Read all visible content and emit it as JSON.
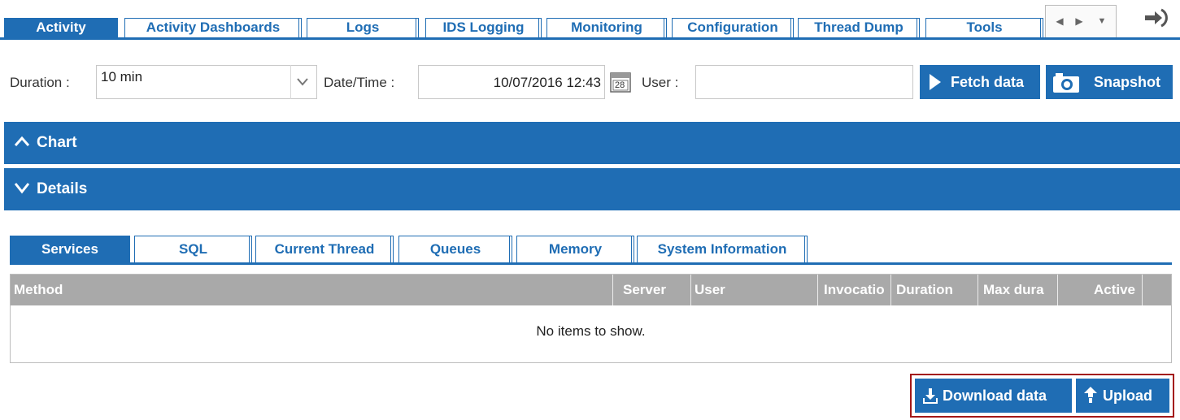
{
  "top_tabs": [
    {
      "label": "Activity",
      "active": true
    },
    {
      "label": "Activity Dashboards",
      "active": false
    },
    {
      "label": "Logs",
      "active": false
    },
    {
      "label": "IDS Logging",
      "active": false
    },
    {
      "label": "Monitoring",
      "active": false
    },
    {
      "label": "Configuration",
      "active": false
    },
    {
      "label": "Thread Dump",
      "active": false
    },
    {
      "label": "Tools",
      "active": false
    }
  ],
  "filters": {
    "duration_label": "Duration :",
    "duration_value": "10 min",
    "datetime_label": "Date/Time :",
    "datetime_value": "10/07/2016 12:43",
    "calendar_day": "28",
    "user_label": "User :",
    "user_value": ""
  },
  "buttons": {
    "fetch": "Fetch data",
    "snapshot": "Snapshot",
    "download": "Download data",
    "upload": "Upload"
  },
  "sections": {
    "chart": "Chart",
    "details": "Details"
  },
  "detail_tabs": [
    {
      "label": "Services",
      "active": true
    },
    {
      "label": "SQL",
      "active": false
    },
    {
      "label": "Current Thread",
      "active": false
    },
    {
      "label": "Queues",
      "active": false
    },
    {
      "label": "Memory",
      "active": false
    },
    {
      "label": "System Information",
      "active": false
    }
  ],
  "grid": {
    "columns": [
      "Method",
      "Server",
      "User",
      "Invocatio",
      "Duration",
      "Max dura",
      "Active"
    ],
    "empty_text": "No items to show."
  },
  "colors": {
    "accent": "#1f6db4",
    "header_gray": "#a9a9a9",
    "highlight_border": "#a31818"
  }
}
